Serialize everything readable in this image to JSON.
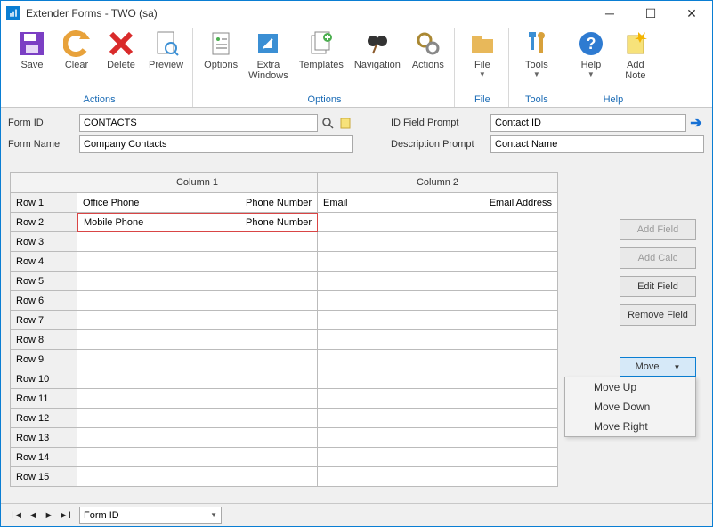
{
  "window": {
    "title": "Extender Forms  -  TWO (sa)"
  },
  "ribbon": {
    "groups": [
      {
        "label": "Actions",
        "buttons": [
          {
            "label": "Save",
            "icon": "save-icon"
          },
          {
            "label": "Clear",
            "icon": "undo-icon"
          },
          {
            "label": "Delete",
            "icon": "delete-x-icon"
          },
          {
            "label": "Preview",
            "icon": "preview-icon"
          }
        ]
      },
      {
        "label": "Options",
        "buttons": [
          {
            "label": "Options",
            "icon": "options-icon"
          },
          {
            "label": "Extra\nWindows",
            "icon": "extra-windows-icon"
          },
          {
            "label": "Templates",
            "icon": "templates-icon"
          },
          {
            "label": "Navigation",
            "icon": "navigation-icon"
          },
          {
            "label": "Actions",
            "icon": "actions-gear-icon"
          }
        ]
      },
      {
        "label": "File",
        "buttons": [
          {
            "label": "File",
            "icon": "file-icon",
            "dropdown": true
          }
        ]
      },
      {
        "label": "Tools",
        "buttons": [
          {
            "label": "Tools",
            "icon": "tools-icon",
            "dropdown": true
          }
        ]
      },
      {
        "label": "Help",
        "buttons": [
          {
            "label": "Help",
            "icon": "help-icon",
            "dropdown": true
          },
          {
            "label": "Add\nNote",
            "icon": "add-note-icon"
          }
        ]
      }
    ]
  },
  "form": {
    "form_id_label": "Form ID",
    "form_id_value": "CONTACTS",
    "form_name_label": "Form Name",
    "form_name_value": "Company Contacts",
    "id_prompt_label": "ID Field Prompt",
    "id_prompt_value": "Contact ID",
    "desc_prompt_label": "Description Prompt",
    "desc_prompt_value": "Contact Name"
  },
  "grid": {
    "col1": "Column 1",
    "col2": "Column 2",
    "rows": [
      {
        "label": "Row 1",
        "c1": {
          "name": "Office Phone",
          "type": "Phone Number"
        },
        "c2": {
          "name": "Email",
          "type": "Email Address"
        }
      },
      {
        "label": "Row 2",
        "c1": {
          "name": "Mobile Phone",
          "type": "Phone Number"
        },
        "c2": {
          "name": "",
          "type": ""
        },
        "selected": "c1"
      },
      {
        "label": "Row 3"
      },
      {
        "label": "Row 4"
      },
      {
        "label": "Row 5"
      },
      {
        "label": "Row 6"
      },
      {
        "label": "Row 7"
      },
      {
        "label": "Row 8"
      },
      {
        "label": "Row 9"
      },
      {
        "label": "Row 10"
      },
      {
        "label": "Row 11"
      },
      {
        "label": "Row 12"
      },
      {
        "label": "Row 13"
      },
      {
        "label": "Row 14"
      },
      {
        "label": "Row 15"
      }
    ]
  },
  "side": {
    "add_field": "Add Field",
    "add_calc": "Add Calc",
    "edit_field": "Edit Field",
    "remove_field": "Remove Field",
    "move": "Move"
  },
  "move_menu": {
    "up": "Move Up",
    "down": "Move Down",
    "right": "Move Right"
  },
  "status": {
    "combo": "Form ID"
  }
}
